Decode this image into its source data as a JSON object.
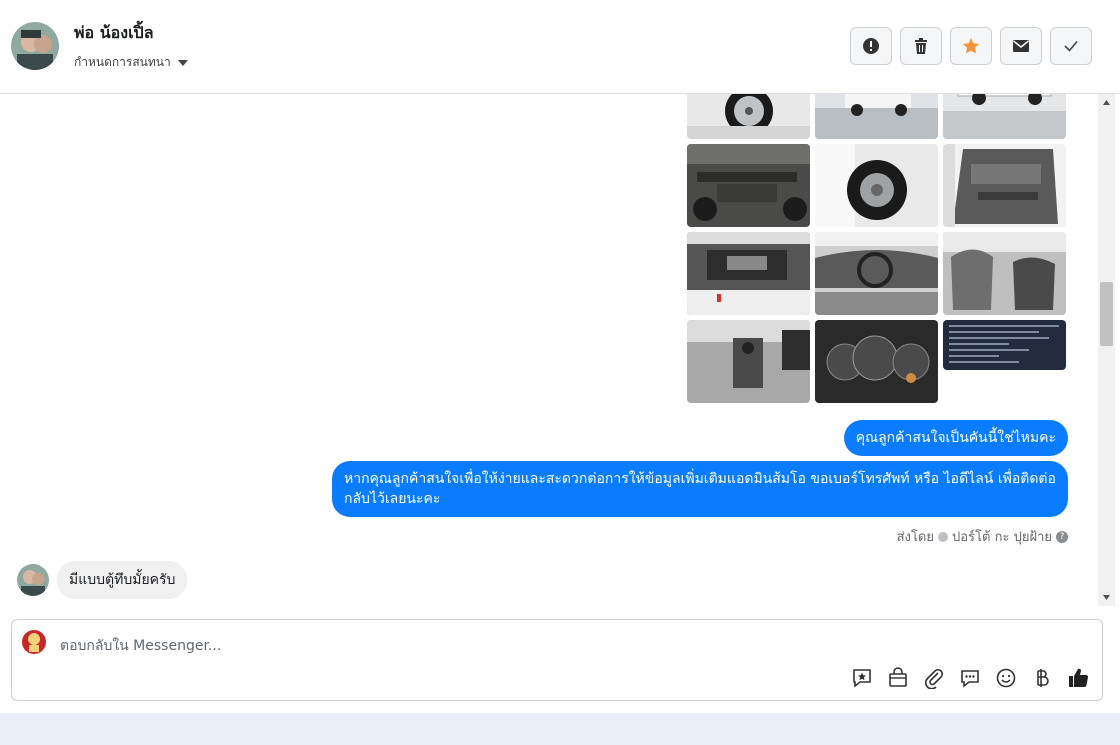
{
  "contact": {
    "name": "พ่อ น้องเปิ้ล",
    "assign_label": "กำหนดการสนทนา"
  },
  "actions": [
    {
      "name": "mark-spam-button",
      "icon": "exclamation-icon"
    },
    {
      "name": "delete-button",
      "icon": "trash-icon"
    },
    {
      "name": "star-button",
      "icon": "star-icon",
      "color": "#f7923b"
    },
    {
      "name": "mark-unread-button",
      "icon": "envelope-icon"
    },
    {
      "name": "mark-done-button",
      "icon": "check-icon"
    }
  ],
  "messages": {
    "outgoing_1": "คุณลูกค้าสนใจเป็นคันนี้ใช่ไหมคะ",
    "outgoing_2": "หากคุณลูกค้าสนใจเพื่อให้ง่ายและสะดวกต่อการให้ข้อมูลเพิ่มเติมแอดมินส้มโอ ขอเบอร์โทรศัพท์ หรือ ไอดีไลน์ เพื่อติดต่อกลับไว้เลยนะคะ",
    "sent_by_prefix": "ส่งโดย",
    "sent_by_name": "ปอร์โต้ กะ ปุยฝ้าย",
    "incoming_1": "มีแบบตู้ทึบมั้ยครับ"
  },
  "photos": [
    "wheel-photo",
    "truck-rear-photo",
    "truck-side-photo",
    "undercarriage-photo",
    "spare-tire-photo",
    "door-interior-photo",
    "engine-photo",
    "dashboard-photo",
    "seats-photo",
    "gear-shift-photo",
    "gauge-cluster-photo",
    "spec-sheet-photo"
  ],
  "composer": {
    "placeholder": "ตอบกลับใน Messenger...",
    "tools": [
      "saved-reply-icon",
      "shop-bag-icon",
      "attachment-icon",
      "chat-bubble-icon",
      "emoji-icon",
      "baht-icon",
      "thumbs-up-icon"
    ]
  },
  "colors": {
    "accent": "#0a7cff",
    "star": "#f7923b"
  }
}
